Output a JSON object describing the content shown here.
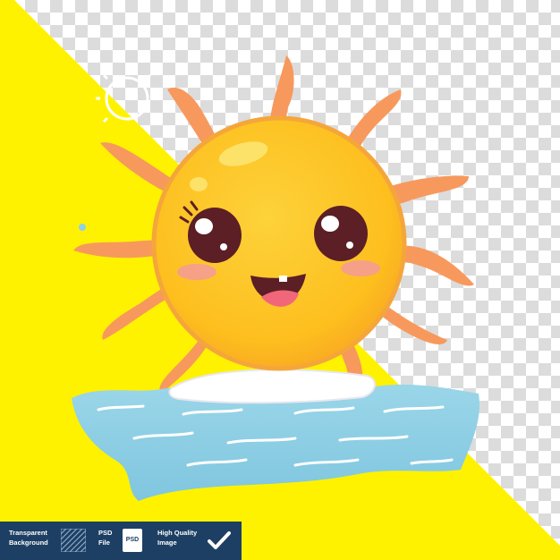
{
  "image": {
    "subject": "sun-character-surfing-icon",
    "colors": {
      "background_yellow": "#fff200",
      "sun_body": "#fdc21c",
      "sun_rays": "#f7995d",
      "water": "#8fd0e6",
      "footer": "#1d3f63"
    }
  },
  "footer": {
    "transparent_line1": "Transparent",
    "transparent_line2": "Background",
    "psd_line1": "PSD",
    "psd_line2": "File",
    "psd_icon_text": "PSD",
    "hq_line1": "High Quality",
    "hq_line2": "Image"
  }
}
